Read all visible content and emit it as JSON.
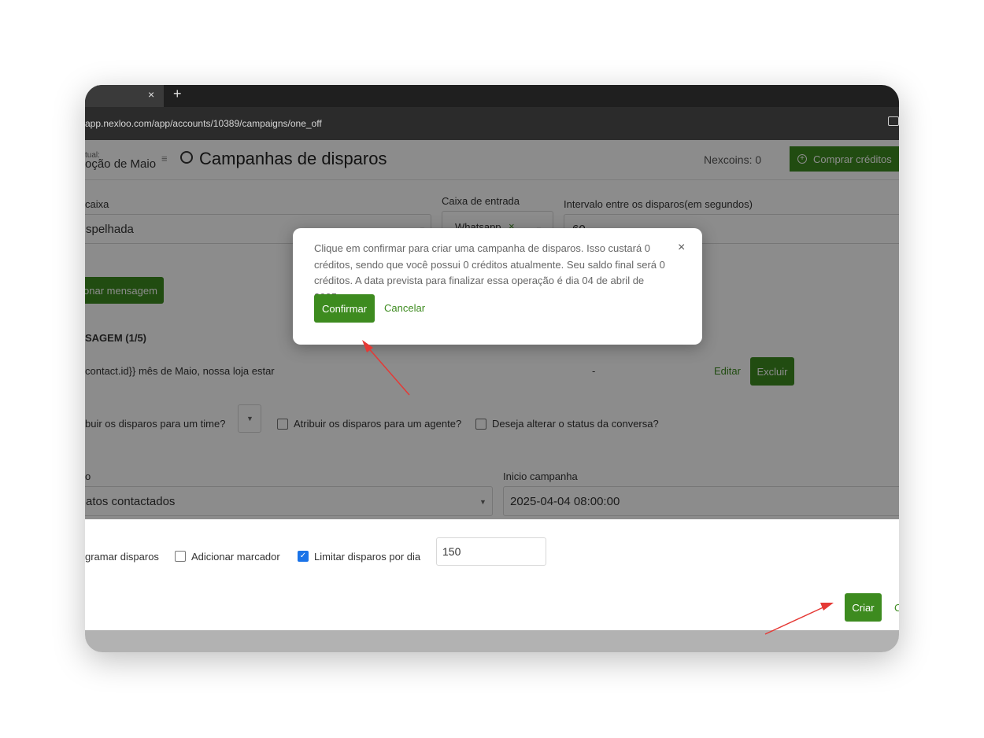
{
  "browser": {
    "tab_close": "×",
    "new_tab": "+",
    "url": "app.nexloo.com/app/accounts/10389/campaigns/one_off"
  },
  "header": {
    "inbox_label": "tual:",
    "inbox_name": "oção de Maio",
    "title": "Campanhas de disparos",
    "nexcoins": "Nexcoins: 0",
    "buy_credits": "Comprar créditos"
  },
  "form": {
    "caixa_label": "caixa",
    "caixa_value": "spelhada",
    "entrada_label": "Caixa de entrada",
    "entrada_tag": "Whatsapp",
    "entrada_tag_remove": "×",
    "intervalo_label": "Intervalo entre os disparos(em segundos)",
    "intervalo_value": "60",
    "add_message": "onar mensagem",
    "message_header": "SAGEM (1/5)",
    "message_text": "contact.id}} mês de Maio, nossa loja estar",
    "message_dash": "-",
    "edit": "Editar",
    "delete": "Excluir",
    "team_question": "buir os disparos para um time?",
    "agent_question": "Atribuir os disparos para um agente?",
    "status_question": "Deseja alterar o status da conversa?",
    "status_label": "o",
    "status_value": "atos contactados",
    "inicio_label": "Inicio campanha",
    "inicio_value": "2025-04-04 08:00:00",
    "programar": "gramar disparos",
    "marcador": "Adicionar marcador",
    "limitar": "Limitar disparos por dia",
    "limit_value": "150",
    "create": "Criar",
    "cancel_cut": "C"
  },
  "modal": {
    "message": "Clique em confirmar para criar uma campanha de disparos. Isso custará 0 créditos, sendo que você possui 0 créditos atualmente. Seu saldo final será 0 créditos. A data prevista para finalizar essa operação é dia 04 de abril de 2025.",
    "close": "×",
    "confirm": "Confirmar",
    "cancel": "Cancelar"
  },
  "colors": {
    "accent": "#3d8b1f",
    "annotation_arrow": "#e53935"
  }
}
